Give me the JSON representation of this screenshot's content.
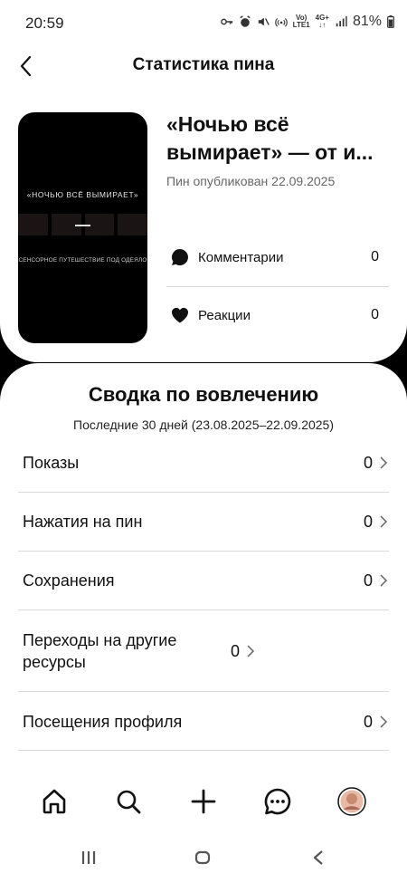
{
  "status": {
    "time": "20:59",
    "network": "4G+",
    "battery": "81%"
  },
  "header": {
    "title": "Статистика пина"
  },
  "pin": {
    "title": "«Ночью всё вымирает» — от и...",
    "published": "Пин опубликован 22.09.2025",
    "thumbnail": {
      "title": "«НОЧЬЮ ВСЁ ВЫМИРАЕТ»",
      "dash": "—",
      "subtitle": "СЕНСОРНОЕ ПУТЕШЕСТВИЕ ПОД ОДЕЯЛО"
    },
    "stats": [
      {
        "label": "Комментарии",
        "value": "0",
        "icon": "comment-icon"
      },
      {
        "label": "Реакции",
        "value": "0",
        "icon": "heart-icon"
      }
    ]
  },
  "engagement": {
    "title": "Сводка по вовлечению",
    "period": "Последние 30 дней (23.08.2025–22.09.2025)",
    "metrics": [
      {
        "label": "Показы",
        "value": "0"
      },
      {
        "label": "Нажатия на пин",
        "value": "0"
      },
      {
        "label": "Сохранения",
        "value": "0"
      },
      {
        "label": "Переходы на другие ресурсы",
        "value": "0"
      },
      {
        "label": "Посещения профиля",
        "value": "0"
      }
    ]
  },
  "tabbar": [
    "home-icon",
    "search-icon",
    "plus-icon",
    "messages-icon",
    "profile-avatar"
  ],
  "system_nav": [
    "recents-icon",
    "home-button-icon",
    "back-icon"
  ]
}
